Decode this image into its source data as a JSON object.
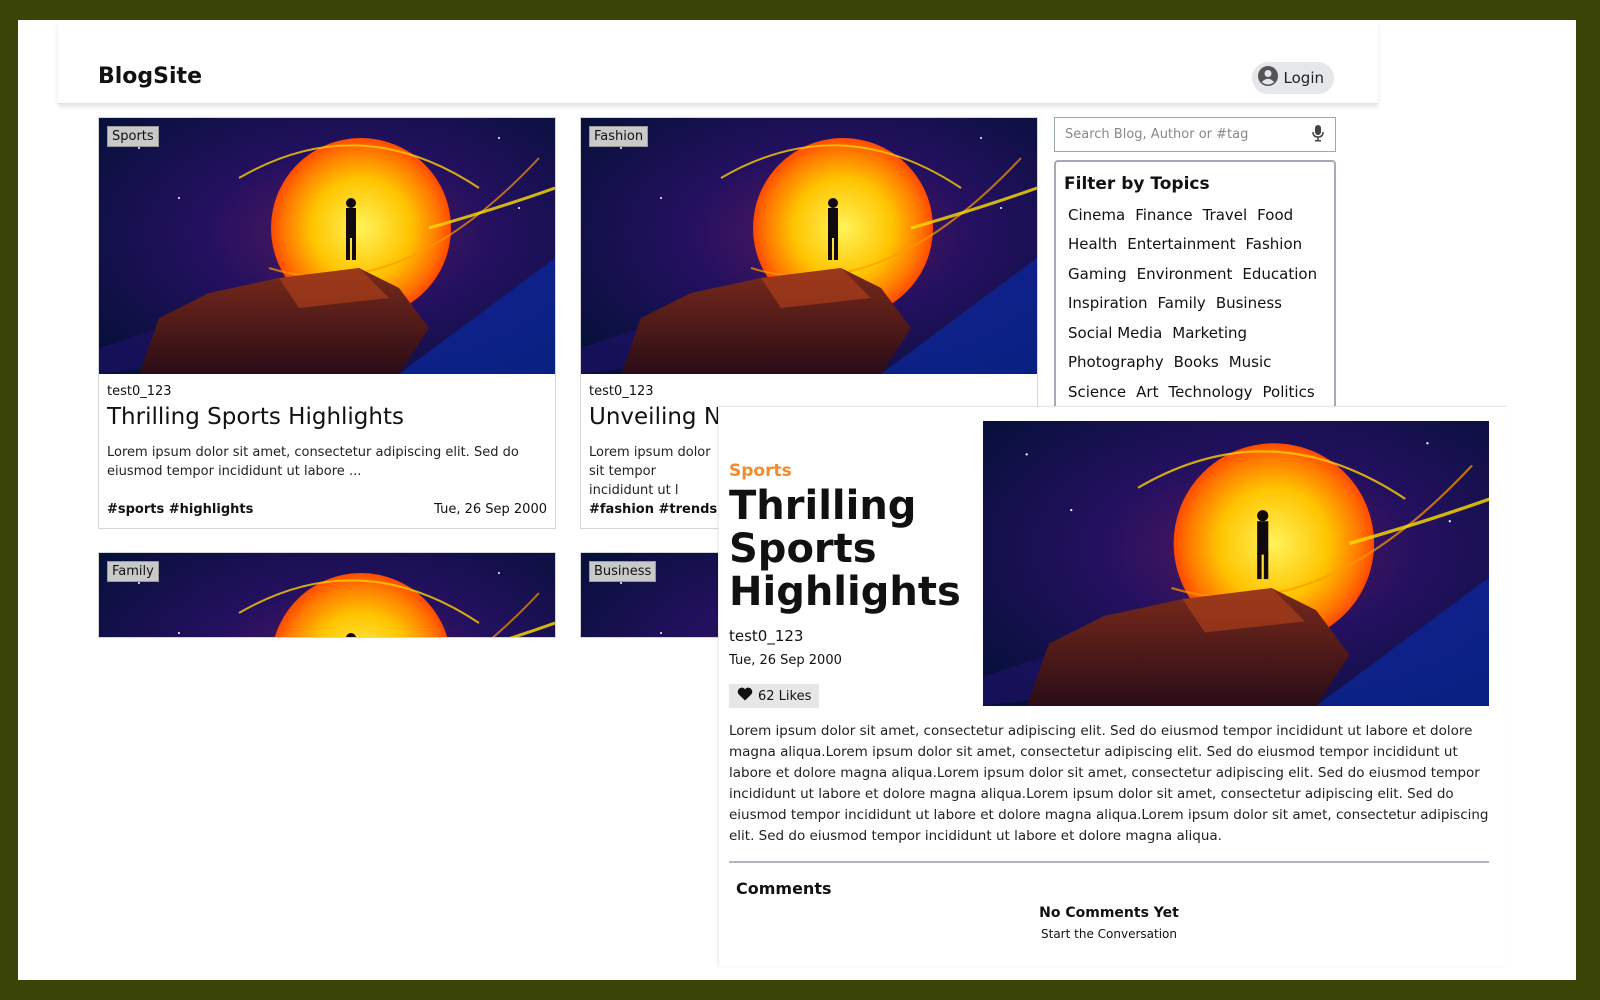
{
  "header": {
    "brand": "BlogSite",
    "login_label": "Login"
  },
  "search": {
    "placeholder": "Search Blog, Author or #tag"
  },
  "topics": {
    "title": "Filter by Topics",
    "rows": [
      [
        "Cinema",
        "Finance",
        "Travel",
        "Food"
      ],
      [
        "Health",
        "Entertainment",
        "Fashion"
      ],
      [
        "Gaming",
        "Environment",
        "Education"
      ],
      [
        "Inspiration",
        "Family",
        "Business"
      ],
      [
        "Social Media",
        "Marketing"
      ],
      [
        "Photography",
        "Books",
        "Music"
      ],
      [
        "Science",
        "Art",
        "Technology",
        "Politics"
      ]
    ]
  },
  "cards": [
    {
      "category": "Sports",
      "author": "test0_123",
      "title": "Thrilling Sports Highlights",
      "description": "Lorem ipsum dolor sit amet, consectetur adipiscing elit. Sed do eiusmod tempor incididunt ut labore ...",
      "tags": "#sports #highlights",
      "date": "Tue, 26 Sep 2000"
    },
    {
      "category": "Fashion",
      "author": "test0_123",
      "title": "Unveiling Ne",
      "description": "Lorem ipsum dolor sit tempor incididunt ut l",
      "tags": "#fashion #trends",
      "date": ""
    },
    {
      "category": "Family"
    },
    {
      "category": "Business"
    }
  ],
  "detail": {
    "category": "Sports",
    "title": "Thrilling Sports Highlights",
    "author": "test0_123",
    "date": "Tue, 26 Sep 2000",
    "likes": "62 Likes",
    "body": "Lorem ipsum dolor sit amet, consectetur adipiscing elit. Sed do eiusmod tempor incididunt ut labore et dolore magna aliqua.Lorem ipsum dolor sit amet, consectetur adipiscing elit. Sed do eiusmod tempor incididunt ut labore et dolore magna aliqua.Lorem ipsum dolor sit amet, consectetur adipiscing elit. Sed do eiusmod tempor incididunt ut labore et dolore magna aliqua.Lorem ipsum dolor sit amet, consectetur adipiscing elit. Sed do eiusmod tempor incididunt ut labore et dolore magna aliqua.Lorem ipsum dolor sit amet, consectetur adipiscing elit. Sed do eiusmod tempor incididunt ut labore et dolore magna aliqua.",
    "comments_title": "Comments",
    "no_comments": "No Comments Yet",
    "start_conversation": "Start the Conversation"
  },
  "colors": {
    "page_border": "#3a4406",
    "accent_category": "#f28a2e",
    "login_bg": "#e6e7ea"
  },
  "icons": {
    "login": "user-circle-icon",
    "search_voice": "microphone-icon",
    "likes": "heart-icon"
  }
}
